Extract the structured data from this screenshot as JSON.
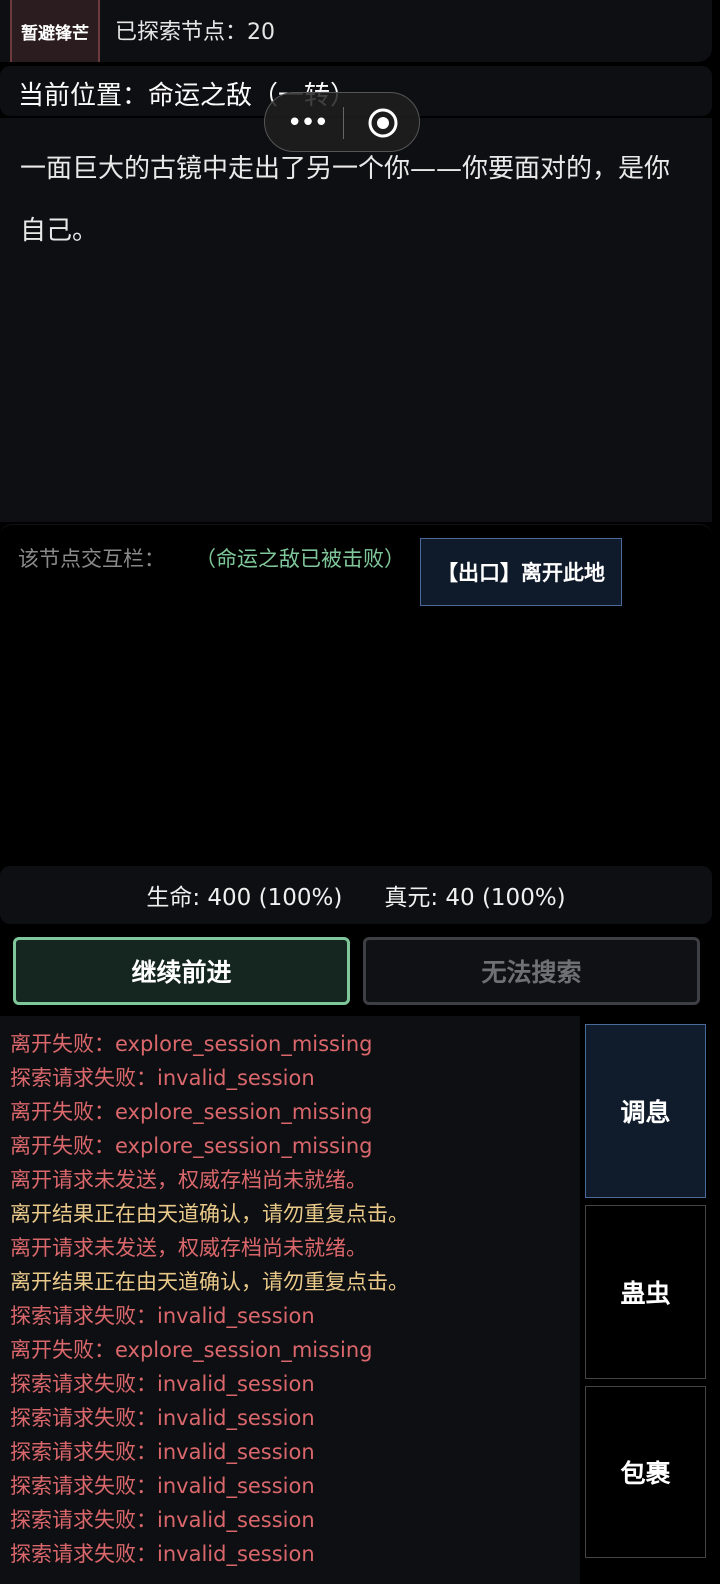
{
  "header": {
    "evade_label": "暂避锋芒",
    "explored_text": "已探索节点：20"
  },
  "location": {
    "text": "当前位置：命运之敌（一转）"
  },
  "capsule": {
    "more_icon": "more-dots-icon",
    "close_icon": "target-circle-icon"
  },
  "description": {
    "text": "一面巨大的古镜中走出了另一个你——你要面对的，是你自己。"
  },
  "interaction": {
    "label": "该节点交互栏：",
    "status": "（命运之敌已被击败）",
    "exit_button": "【出口】离开此地"
  },
  "stats": {
    "hp": "生命: 400 (100%)",
    "mp": "真元: 40 (100%)"
  },
  "actions": {
    "forward": "继续前进",
    "search": "无法搜索"
  },
  "log": [
    {
      "text": "离开失败：explore_session_missing",
      "tone": "red"
    },
    {
      "text": "探索请求失败：invalid_session",
      "tone": "red"
    },
    {
      "text": "离开失败：explore_session_missing",
      "tone": "red"
    },
    {
      "text": "离开失败：explore_session_missing",
      "tone": "red"
    },
    {
      "text": "离开请求未发送，权威存档尚未就绪。",
      "tone": "red"
    },
    {
      "text": "离开结果正在由天道确认，请勿重复点击。",
      "tone": "yellow"
    },
    {
      "text": "离开请求未发送，权威存档尚未就绪。",
      "tone": "red"
    },
    {
      "text": "离开结果正在由天道确认，请勿重复点击。",
      "tone": "yellow"
    },
    {
      "text": "探索请求失败：invalid_session",
      "tone": "red"
    },
    {
      "text": "离开失败：explore_session_missing",
      "tone": "red"
    },
    {
      "text": "探索请求失败：invalid_session",
      "tone": "red"
    },
    {
      "text": "探索请求失败：invalid_session",
      "tone": "red"
    },
    {
      "text": "探索请求失败：invalid_session",
      "tone": "red"
    },
    {
      "text": "探索请求失败：invalid_session",
      "tone": "red"
    },
    {
      "text": "探索请求失败：invalid_session",
      "tone": "red"
    },
    {
      "text": "探索请求失败：invalid_session",
      "tone": "red"
    }
  ],
  "side_menu": {
    "rest": "调息",
    "gu": "蛊虫",
    "bag": "包裹"
  },
  "colors": {
    "accent_green": "#7fc79a",
    "error_red": "#d9676b",
    "warn_yellow": "#e9c98a",
    "active_blue_border": "#4a6a9a"
  }
}
